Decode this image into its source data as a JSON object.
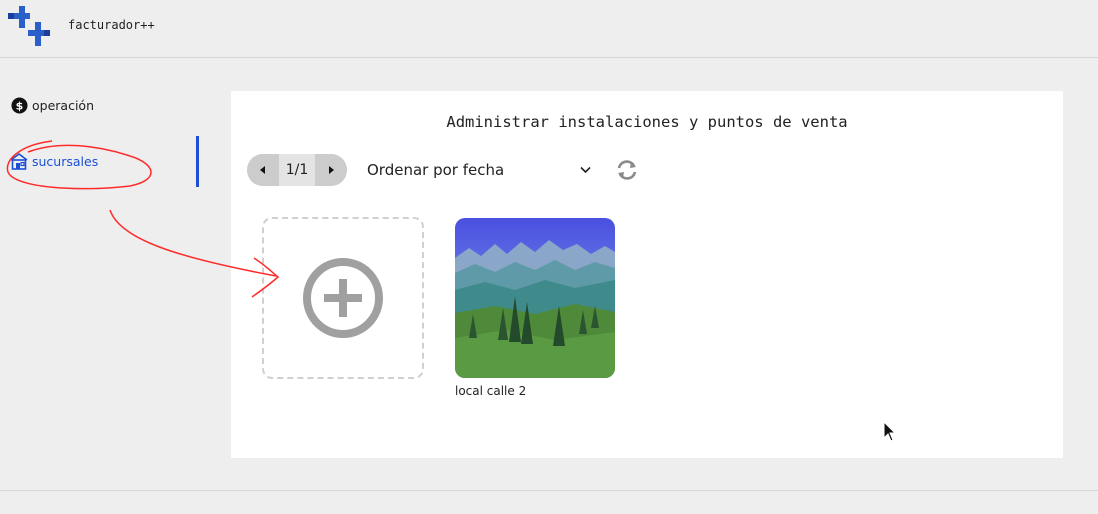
{
  "app": {
    "title": "facturador++"
  },
  "sidebar": {
    "items": [
      {
        "label": "operación",
        "icon": "dollar-circle-icon"
      },
      {
        "label": "sucursales",
        "icon": "store-icon",
        "active": true
      }
    ]
  },
  "main": {
    "title": "Administrar instalaciones y puntos de venta",
    "pager": {
      "label": "1/1"
    },
    "sort": {
      "selected": "Ordenar por fecha"
    },
    "branches": [
      {
        "name": "local calle 2",
        "thumbnail": "landscape-image"
      }
    ]
  },
  "colors": {
    "accent": "#1a4fd6",
    "annotation": "#ff2a2a"
  }
}
